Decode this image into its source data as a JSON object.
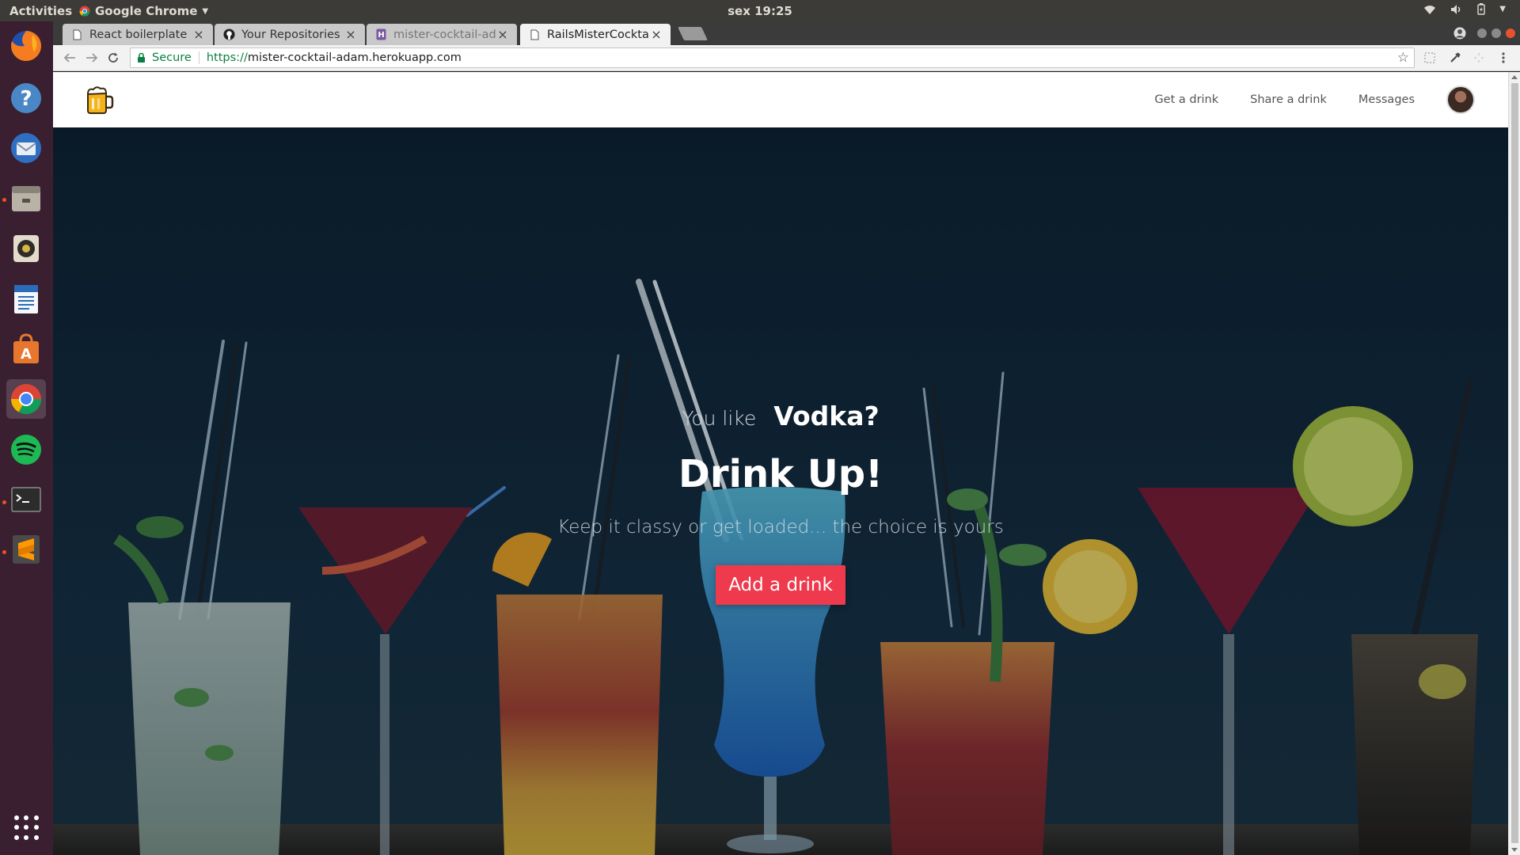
{
  "system": {
    "activities": "Activities",
    "app_name": "Google Chrome",
    "clock": "sex 19:25"
  },
  "browser": {
    "tabs": [
      {
        "title": "React boilerplate",
        "icon": "page-icon"
      },
      {
        "title": "Your Repositories",
        "icon": "github-icon"
      },
      {
        "title": "mister-cocktail-ada",
        "icon": "heroku-icon"
      },
      {
        "title": "RailsMisterCocktail",
        "icon": "page-icon",
        "active": true
      }
    ],
    "address": {
      "secure_label": "Secure",
      "protocol": "https://",
      "host": "mister-cocktail-adam.herokuapp.com"
    }
  },
  "site": {
    "nav": {
      "get_drink": "Get a drink",
      "share_drink": "Share a drink",
      "messages": "Messages"
    },
    "hero": {
      "prefix": "You like",
      "drink": "Vodka?",
      "headline": "Drink Up!",
      "tagline": "Keep it classy or get loaded... the choice is yours",
      "cta": "Add a drink"
    }
  },
  "colors": {
    "cta": "#ee3a4c",
    "hero_bg": "#112638",
    "dock_bg": "#3a1f31",
    "topbar_bg": "#3c3b37"
  }
}
